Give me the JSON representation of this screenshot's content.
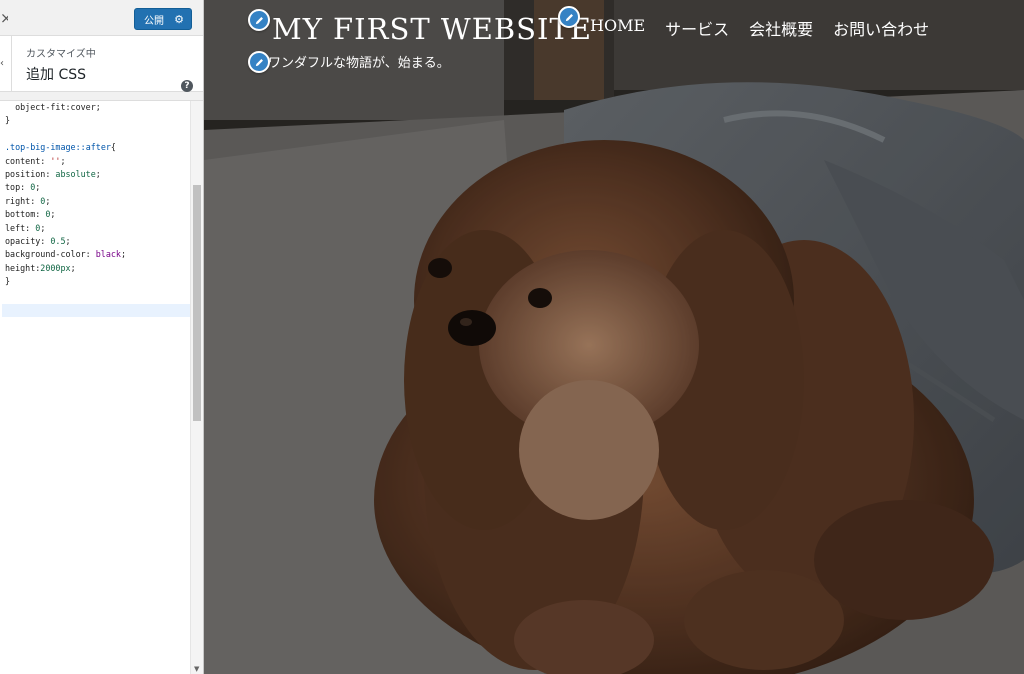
{
  "sidebar": {
    "close_icon": "×",
    "publish_label": "公開",
    "breadcrumb": "カスタマイズ中",
    "section_title": "追加 CSS",
    "help_icon": "?"
  },
  "code": [
    [
      [
        "  object-fit:cover;",
        "prop"
      ]
    ],
    [
      [
        "}",
        "prop"
      ]
    ],
    [
      [
        "",
        "prop"
      ]
    ],
    [
      [
        ".top-big-image::",
        "sel"
      ],
      [
        "after",
        "sel"
      ],
      [
        "{",
        "prop"
      ]
    ],
    [
      [
        "content: ",
        "prop"
      ],
      [
        "''",
        "str"
      ],
      [
        ";",
        "prop"
      ]
    ],
    [
      [
        "position: ",
        "prop"
      ],
      [
        "absolute",
        "num"
      ],
      [
        ";",
        "prop"
      ]
    ],
    [
      [
        "top: ",
        "prop"
      ],
      [
        "0",
        "num"
      ],
      [
        ";",
        "prop"
      ]
    ],
    [
      [
        "right: ",
        "prop"
      ],
      [
        "0",
        "num"
      ],
      [
        ";",
        "prop"
      ]
    ],
    [
      [
        "bottom: ",
        "prop"
      ],
      [
        "0",
        "num"
      ],
      [
        ";",
        "prop"
      ]
    ],
    [
      [
        "left: ",
        "prop"
      ],
      [
        "0",
        "num"
      ],
      [
        ";",
        "prop"
      ]
    ],
    [
      [
        "opacity: ",
        "prop"
      ],
      [
        "0.5",
        "num"
      ],
      [
        ";",
        "prop"
      ]
    ],
    [
      [
        "background-color: ",
        "prop"
      ],
      [
        "black",
        "kw"
      ],
      [
        ";",
        "prop"
      ]
    ],
    [
      [
        "height:",
        "prop"
      ],
      [
        "2000px",
        "num"
      ],
      [
        ";",
        "prop"
      ]
    ],
    [
      [
        "}",
        "prop"
      ]
    ]
  ],
  "preview": {
    "site_title": "MY FIRST WEBSITE",
    "tagline": "ワンダフルな物語が、始まる。",
    "nav": [
      "HOME",
      "サービス",
      "会社概要",
      "お問い合わせ"
    ]
  },
  "colors": {
    "accent": "#2271b1",
    "edit_shortcut": "#3582c4"
  }
}
